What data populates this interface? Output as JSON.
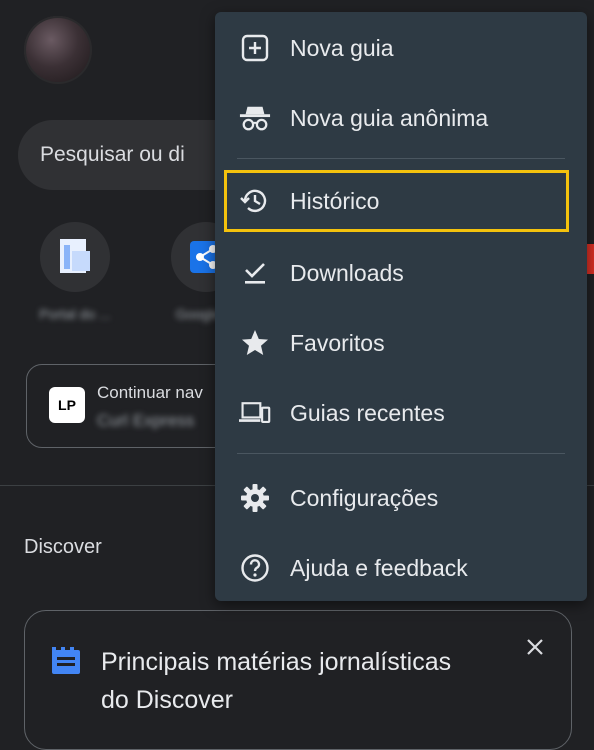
{
  "search": {
    "placeholder": "Pesquisar ou di"
  },
  "shortcuts": [
    {
      "label": "Portal do ..."
    },
    {
      "label": "Google ..."
    }
  ],
  "continue_card": {
    "line1": "Continuar nav",
    "line2": "Curl Express",
    "logo_text": "LP"
  },
  "discover": {
    "label": "Discover"
  },
  "discover_card": {
    "title": "Principais matérias jornalísticas do Discover"
  },
  "menu": {
    "items": [
      {
        "label": "Nova guia",
        "icon": "plus-box-icon"
      },
      {
        "label": "Nova guia anônima",
        "icon": "incognito-icon"
      },
      {
        "label": "Histórico",
        "icon": "history-icon",
        "highlighted": true
      },
      {
        "label": "Downloads",
        "icon": "download-check-icon"
      },
      {
        "label": "Favoritos",
        "icon": "star-icon"
      },
      {
        "label": "Guias recentes",
        "icon": "devices-icon"
      },
      {
        "label": "Configurações",
        "icon": "gear-icon"
      },
      {
        "label": "Ajuda e feedback",
        "icon": "help-icon"
      }
    ]
  },
  "colors": {
    "highlight_border": "#f4c20d",
    "menu_bg": "#2e3a44",
    "page_bg": "#202124",
    "accent_blue": "#4285f4"
  }
}
